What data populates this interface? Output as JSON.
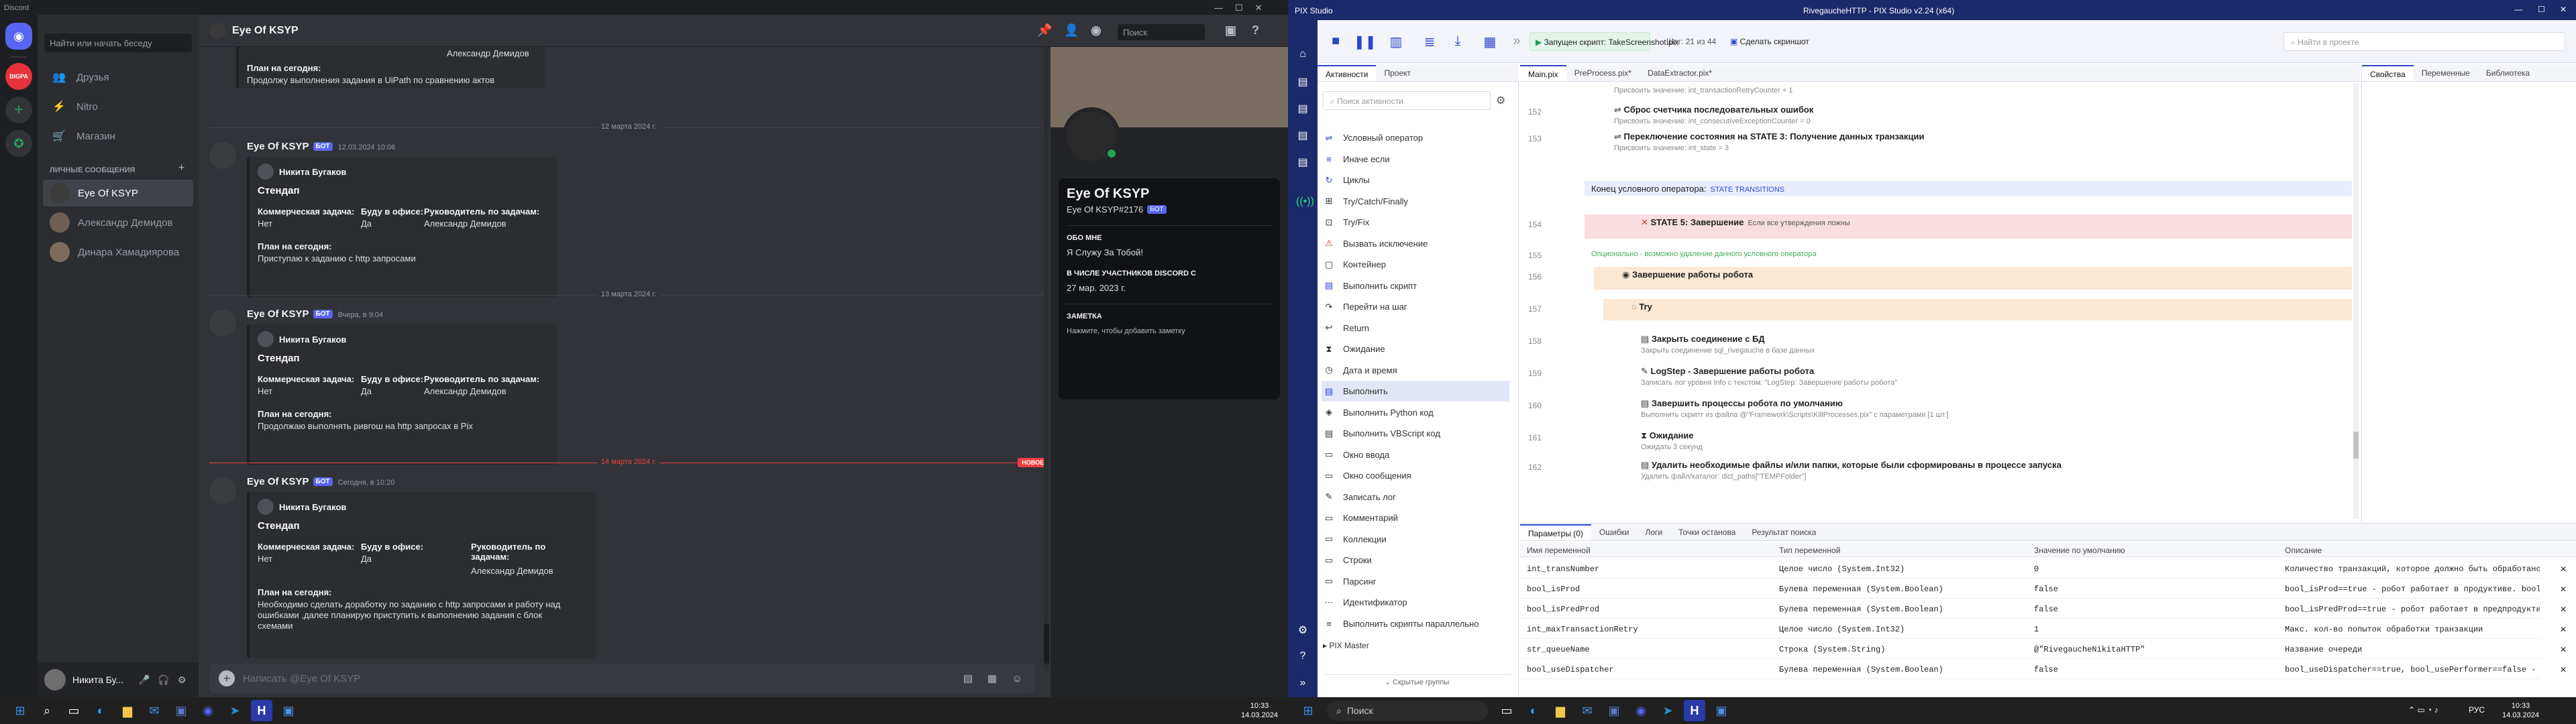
{
  "discord": {
    "window_title": "Discord",
    "search_placeholder": "Найти или начать беседу",
    "nav": [
      "Друзья",
      "Nitro",
      "Магазин"
    ],
    "guild_label": "BIGPA",
    "dm_section_label": "ЛИЧНЫЕ СООБЩЕНИЯ",
    "dm_add": "+",
    "dms": [
      "Eye Of KSYP",
      "Александр Демидов",
      "Динара Хамадиярова"
    ],
    "channel_name": "Eye Of KSYP",
    "header_search": "Поиск",
    "messages_top": {
      "plan_label": "План на сегодня:",
      "plan_value": "Продолжу выполнения задания в UiPath по сравнению актов",
      "partial_author": "Александр Демидов"
    },
    "dividers": [
      "12 марта 2024 г.",
      "13 марта 2024 г.",
      "14 марта 2024 г."
    ],
    "new_label": "НОВОЕ",
    "bot_label": "БОТ",
    "msg_author": "Eye Of KSYP",
    "messages": [
      {
        "time": "12.03.2024 10:06",
        "embed_author": "Никита Бугаков",
        "title": "Стендап",
        "f1n": "Коммерческая задача:",
        "f1v": "Нет",
        "f2n": "Буду в офисе:",
        "f2v": "Да",
        "f3n": "Руководитель по задачам:",
        "f3v": "Александр Демидов",
        "pn": "План на сегодня:",
        "pv": "Приступаю к заданию с http запросами"
      },
      {
        "time": "Вчера, в 9:04",
        "embed_author": "Никита Бугаков",
        "title": "Стендап",
        "f1n": "Коммерческая задача:",
        "f1v": "Нет",
        "f2n": "Буду в офисе:",
        "f2v": "Да",
        "f3n": "Руководитель по задачам:",
        "f3v": "Александр Демидов",
        "pn": "План на сегодня:",
        "pv": "Продолжаю выполнять ривгош на http запросах в Pix"
      },
      {
        "time": "Сегодня, в 10:20",
        "embed_author": "Никита Бугаков",
        "title": "Стендап",
        "f1n": "Коммерческая задача:",
        "f1v": "Нет",
        "f2n": "Буду в офисе:",
        "f2v": "Да",
        "f3n": "Руководитель по задачам:",
        "f3v": "Александр Демидов",
        "pn": "План на сегодня:",
        "pv": "Необходимо сделать доработку по заданию с http запросами и работу над ошибками ,далее планирую приступить к выполнению задания с блок схемами"
      }
    ],
    "input_placeholder": "Написать @Eye Of KSYP",
    "profile": {
      "name": "Eye Of KSYP",
      "tag": "Eye Of KSYP#2176",
      "about_label": "ОБО МНЕ",
      "about_value": "Я Служу За Тобой!",
      "member_since_label": "В ЧИСЛЕ УЧАСТНИКОВ DISCORD С",
      "member_since_value": "27 мар. 2023 г.",
      "note_label": "ЗАМЕТКА",
      "note_placeholder": "Нажмите, чтобы добавить заметку"
    },
    "user_panel": {
      "name": "Никита Бу..."
    },
    "clock": {
      "time": "10:33",
      "date": "14.03.2024"
    }
  },
  "pix": {
    "left_title": "PIX Studio",
    "title": "RivegaucheHTTP - PIX Studio v2.24 (x64)",
    "toolbar": {
      "run_status": "Запущен скрипт: TakeScreenshot.pix",
      "position": "Шаг: 21 из 44",
      "screenshot_btn": "Сделать скриншот",
      "search_placeholder": "Найти в проекте"
    },
    "left_tabs": [
      "Активности",
      "Проект"
    ],
    "activity_search": "Поиск активности",
    "activities": [
      "Условный оператор",
      "Иначе если",
      "Циклы",
      "Try/Catch/Finally",
      "Try/Fix",
      "Вызвать исключение",
      "Контейнер",
      "Выполнить скрипт",
      "Перейти на шаг",
      "Return",
      "Ожидание",
      "Дата и время",
      "Выполнить",
      "Выполнить Python код",
      "Выполнить VBScript код",
      "Окно ввода",
      "Окно сообщения",
      "Записать лог",
      "Комментарий",
      "Коллекции",
      "Строки",
      "Парсинг",
      "Идентификатор",
      "Выполнить скрипты параллельно"
    ],
    "activity_groups": [
      "PIX Master",
      "Скрытые группы"
    ],
    "editor_tabs": [
      "Main.pix",
      "PreProcess.pix*",
      "DataExtractor.pix*"
    ],
    "right_tabs": [
      "Свойства",
      "Переменные",
      "Библиотека"
    ],
    "lines": [
      {
        "n": "",
        "title": "Присвоить значение: int_transactionRetryCounter + 1",
        "sub": ""
      },
      {
        "n": "152",
        "title": "Сброс счетчика последовательных ошибок",
        "sub": "Присвоить значение: int_consecutiveExceptionCounter = 0"
      },
      {
        "n": "153",
        "title": "Переключение состояния на STATE 3: Получение данных транзакции",
        "sub": "Присвоить значение: int_state = 3"
      },
      {
        "n": "",
        "title": "Конец условного оператора:",
        "sub": "STATE TRANSITIONS"
      },
      {
        "n": "154",
        "title": "STATE 5: Завершение",
        "sub": "Если все утверждения ложны"
      },
      {
        "n": "155",
        "title": "Опционально - возможно удаление данного условного оператора",
        "sub": ""
      },
      {
        "n": "156",
        "title": "Завершение работы робота",
        "sub": ""
      },
      {
        "n": "157",
        "title": "Try",
        "sub": ""
      },
      {
        "n": "158",
        "title": "Закрыть соединение с БД",
        "sub": "Закрыть соединение sql_rivegauche в базе данных"
      },
      {
        "n": "159",
        "title": "LogStep - Завершение работы робота",
        "sub": "Записать лог уровня Info с текстом: \"LogStep: Завершение работы робота\""
      },
      {
        "n": "160",
        "title": "Завершить процессы робота по умолчанию",
        "sub": "Выполнить скрипт из файла @\"Framework\\Scripts\\KillProcesses.pix\" с параметрами [1 шт.]"
      },
      {
        "n": "161",
        "title": "Ожидание",
        "sub": "Ожидать 3 секунд"
      },
      {
        "n": "162",
        "title": "Удалить необходимые файлы и/или папки, которые были сформированы в процессе запуска",
        "sub": "Удалить файл/каталог: dict_paths[\"TEMPFolder\"]"
      }
    ],
    "bottom_tabs": [
      "Параметры (0)",
      "Ошибки",
      "Логи",
      "Точки останова",
      "Результат поиска"
    ],
    "var_headers": [
      "Имя переменной",
      "Тип переменной",
      "Значение по умолчанию",
      "Описание"
    ],
    "vars": [
      [
        "int_transNumber",
        "Целое число (System.Int32)",
        "0",
        "Количество транзакций, которое должно быть обработано"
      ],
      [
        "bool_isProd",
        "Булева переменная (System.Boolean)",
        "false",
        "bool_isProd==true - робот работает в продуктиве. bool_isProd==false -"
      ],
      [
        "bool_isPredProd",
        "Булева переменная (System.Boolean)",
        "false",
        "bool_isPredProd==true - робот работает в предпродуктиве"
      ],
      [
        "int_maxTransactionRetry",
        "Целое число (System.Int32)",
        "1",
        "Макс. кол-во попыток обработки транзакции"
      ],
      [
        "str_queueName",
        "Строка (System.String)",
        "@\"RivegaucheNikitaHTTP\"",
        "Название очереди"
      ],
      [
        "bool_useDispatcher",
        "Булева переменная (System.Boolean)",
        "false",
        "bool_useDispatcher==true, bool_usePerformer==false - использовать"
      ]
    ],
    "clock": {
      "time": "10:33",
      "date": "14.03.2024"
    },
    "taskbar_search": "Поиск",
    "lang": "РУС"
  },
  "colors": {
    "discord_bg": "#313338",
    "pix_blue": "#1b2a6b",
    "accent": "#5865f2",
    "state_pink": "#f8dede",
    "state_peach": "#fde8d4"
  }
}
